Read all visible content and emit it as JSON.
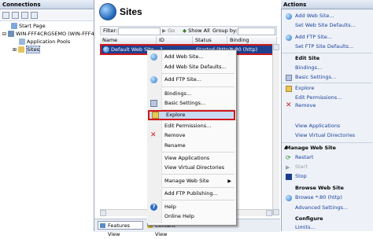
{
  "connections": {
    "title": "Connections",
    "tree": [
      {
        "label": "Start Page"
      },
      {
        "label": "WIN-FFF4CRG5EMO (WIN-FFF4..."
      },
      {
        "label": "Application Pools"
      },
      {
        "label": "Sites"
      }
    ]
  },
  "center": {
    "title": "Sites",
    "filter_label": "Filter:",
    "go_label": "Go",
    "show_all_label": "Show All",
    "group_by_label": "Group by:",
    "columns": [
      "Name",
      "ID",
      "Status",
      "Binding"
    ],
    "rows": [
      {
        "name": "Default Web Site",
        "id": "1",
        "status": "Started (http)",
        "binding": "*:80 (http)"
      }
    ],
    "view_tabs": [
      "Features View",
      "Content View"
    ]
  },
  "context_menu": {
    "items": [
      "Add Web Site...",
      "Add Web Site Defaults...",
      "Add FTP Site...",
      "Bindings...",
      "Basic Settings...",
      "Explore",
      "Edit Permissions...",
      "Remove",
      "Rename",
      "View Applications",
      "View Virtual Directories",
      "Manage Web Site",
      "Add FTP Publishing...",
      "Help",
      "Online Help"
    ]
  },
  "actions": {
    "title": "Actions",
    "top_items": [
      "Add Web Site...",
      "Set Web Site Defaults...",
      "Add FTP Site...",
      "Set FTP Site Defaults..."
    ],
    "edit_site": {
      "heading": "Edit Site",
      "items": [
        "Bindings...",
        "Basic Settings...",
        "Explore",
        "Edit Permissions...",
        "Remove",
        "View Applications",
        "View Virtual Directories"
      ]
    },
    "manage": {
      "heading": "Manage Web Site",
      "items": [
        "Restart",
        "Start",
        "Stop"
      ]
    },
    "browse": {
      "heading": "Browse Web Site",
      "items": [
        "Browse *:80 (http)",
        "Advanced Settings..."
      ]
    },
    "configure": {
      "heading": "Configure",
      "items": [
        "Limits..."
      ]
    }
  },
  "colors": {
    "highlight_red": "#d11a1a",
    "selection_blue": "#1f3f8f",
    "link_blue": "#1a3f9a"
  }
}
